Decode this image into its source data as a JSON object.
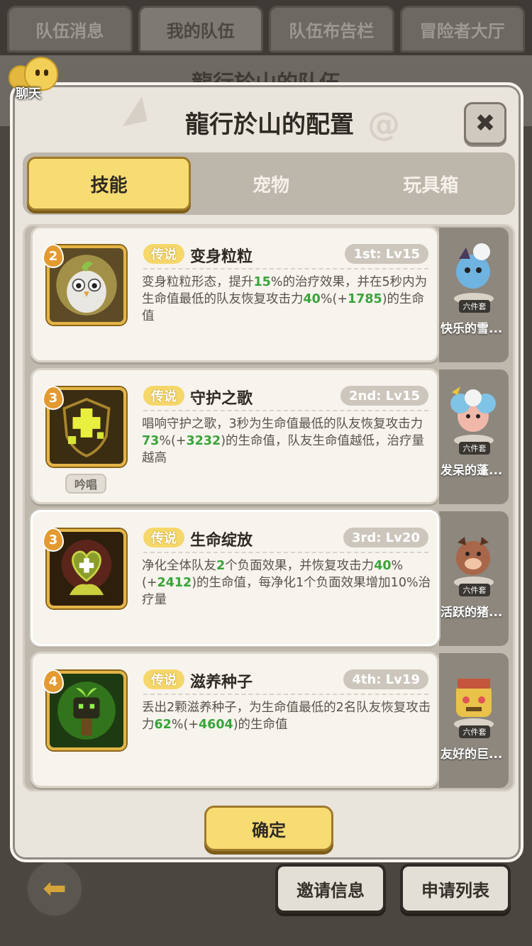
{
  "top_tabs": [
    {
      "label": "队伍消息",
      "active": false
    },
    {
      "label": "我的队伍",
      "active": true
    },
    {
      "label": "队伍布告栏",
      "active": false
    },
    {
      "label": "冒险者大厅",
      "active": false
    }
  ],
  "background_title": "龍行於山的队伍",
  "chat": {
    "label": "聊天"
  },
  "modal": {
    "title": "龍行於山的配置",
    "close_icon": "close-icon",
    "tabs": [
      {
        "label": "技能",
        "active": true
      },
      {
        "label": "宠物",
        "active": false
      },
      {
        "label": "玩具箱",
        "active": false
      }
    ],
    "skills": [
      {
        "rank": "2",
        "rarity": "传说",
        "name": "变身粒粒",
        "level": "1st: Lv15",
        "chant": "",
        "desc": [
          "变身粒粒形态，提升",
          {
            "g": "15"
          },
          "%的治疗效果，并在5秒内为生命值最低的队友恢复攻击力",
          {
            "g": "40"
          },
          "%(+",
          {
            "g": "1785"
          },
          ")的生命值"
        ],
        "icon": "owl-skill-icon"
      },
      {
        "rank": "3",
        "rarity": "传说",
        "name": "守护之歌",
        "level": "2nd: Lv15",
        "chant": "吟唱",
        "desc": [
          "唱响守护之歌，3秒为生命值最低的队友恢复攻击力",
          {
            "g": "73"
          },
          "%(+",
          {
            "g": "3232"
          },
          ")的生命值，队友生命值越低，治疗量越高"
        ],
        "icon": "shield-cross-skill-icon"
      },
      {
        "rank": "3",
        "rarity": "传说",
        "name": "生命绽放",
        "level": "3rd: Lv20",
        "chant": "",
        "desc": [
          "净化全体队友",
          {
            "g": "2"
          },
          "个负面效果，并恢复攻击力",
          {
            "g": "40"
          },
          "%(+",
          {
            "g": "2412"
          },
          ")的生命值，每净化1个负面效果增加10%治疗量"
        ],
        "icon": "heart-flower-skill-icon"
      },
      {
        "rank": "4",
        "rarity": "传说",
        "name": "滋养种子",
        "level": "4th: Lv19",
        "chant": "",
        "desc": [
          "丢出2颗滋养种子，为生命值最低的2名队友恢复攻击力",
          {
            "g": "62"
          },
          "%(+",
          {
            "g": "4604"
          },
          ")的生命值"
        ],
        "icon": "sprout-skill-icon"
      }
    ],
    "pets": [
      {
        "name": "快乐的雪...",
        "set": "六件套",
        "color": "#6fb3e0"
      },
      {
        "name": "发呆的蓬...",
        "set": "六件套",
        "color": "#7fc3e6"
      },
      {
        "name": "活跃的猪...",
        "set": "六件套",
        "color": "#a8674a"
      },
      {
        "name": "友好的巨...",
        "set": "六件套",
        "color": "#e9c24a"
      }
    ],
    "confirm_label": "确定"
  },
  "bottom": {
    "back_icon": "back-arrow-icon",
    "invite_label": "邀请信息",
    "apply_label": "申请列表"
  }
}
